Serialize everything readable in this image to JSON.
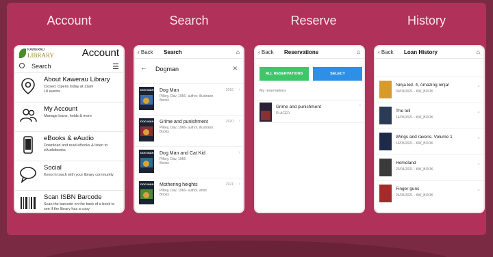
{
  "headings": {
    "account": "Account",
    "search": "Search",
    "reserve": "Reserve",
    "history": "History"
  },
  "colors": {
    "panel": "#b0325a",
    "frame": "#7b2a44",
    "green_button": "#3fc56a",
    "blue_button": "#2e8fe6"
  },
  "account": {
    "logo_small": "KAWERAU",
    "logo_big": "LIBRARY",
    "title": "Account",
    "search_label": "Search",
    "items": [
      {
        "title": "About Kawerau Library",
        "desc": "Closed. Opens today at 11am\n18 events",
        "icon": "location-pin-icon"
      },
      {
        "title": "My Account",
        "desc": "Manage loans, holds & more",
        "icon": "users-icon"
      },
      {
        "title": "eBooks & eAudio",
        "desc": "Download and read eBooks & listen to eAudiobooks",
        "icon": "phone-device-icon"
      },
      {
        "title": "Social",
        "desc": "Keep in touch with your library community",
        "icon": "chat-bubble-icon"
      },
      {
        "title": "Scan ISBN Barcode",
        "desc": "Scan the barcode on the back of a book to see if the library has a copy",
        "icon": "barcode-icon"
      }
    ]
  },
  "search": {
    "back": "Back",
    "title": "Search",
    "query": "Dogman",
    "results": [
      {
        "title": "Dog Man",
        "meta": "Pilkey, Dav, 1966- author, illustrator.\nBooks",
        "year": "2016",
        "cover_text": "DOG MAN"
      },
      {
        "title": "Grime and punishment",
        "meta": "Pilkey, Dav, 1966- author, illustrator.\nBooks",
        "year": "2020",
        "cover_text": "DOG MAN"
      },
      {
        "title": "Dog Man and Cat Kid",
        "meta": "Pilkey, Dav, 1966-\nBooks",
        "year": "",
        "cover_text": "DOG MAN"
      },
      {
        "title": "Mothering heights",
        "meta": "Pilkey, Dav, 1966- author, artist.\nBooks",
        "year": "2021",
        "cover_text": "DOG MAN"
      }
    ]
  },
  "reserve": {
    "back": "Back",
    "title": "Reservations",
    "btn_all": "ALL RESERVATIONS",
    "btn_select": "SELECT",
    "section_label": "My reservations",
    "items": [
      {
        "title": "Grime and punishment",
        "status": "PLACED"
      }
    ]
  },
  "history": {
    "back": "Back",
    "title": "Loan History",
    "loans": [
      {
        "title": "Ninja kid. 4, Amazing ninja!",
        "meta": "30/03/2021 - KW_BOOK",
        "cover": "#d79b2c"
      },
      {
        "title": "The tell",
        "meta": "14/05/2021 - KW_BOOK",
        "cover": "#2c3b55"
      },
      {
        "title": "Wings and ravens. Volume 1",
        "meta": "14/05/2021 - KW_BOOK",
        "cover": "#1d2a4a"
      },
      {
        "title": "Homeland",
        "meta": "23/04/2021 - KW_BOOK",
        "cover": "#3a3a3a"
      },
      {
        "title": "Finger guns",
        "meta": "24/05/2021 - KW_BOOK",
        "cover": "#a52a2a"
      }
    ]
  }
}
